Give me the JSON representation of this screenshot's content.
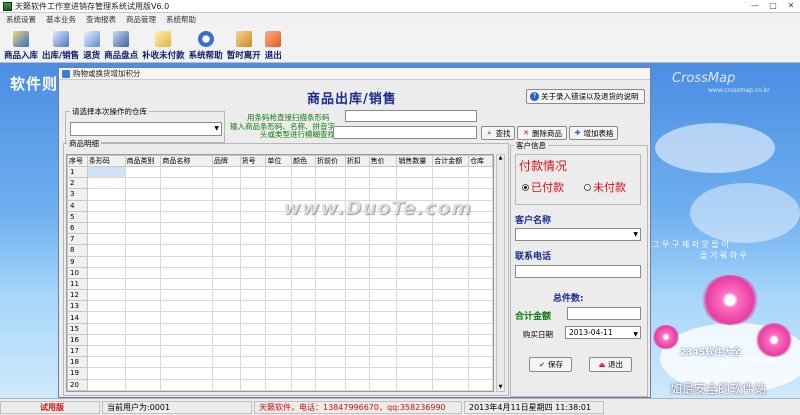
{
  "app": {
    "title": "天籁软件工作室进销存管理系统试用版V6.0"
  },
  "menubar": [
    "系统设置",
    "基本业务",
    "查询报表",
    "商品管理",
    "系统帮助"
  ],
  "toolbar": [
    {
      "label": "商品入库",
      "icon": "books-icon",
      "color": "#2f6fc6"
    },
    {
      "label": "出库/销售",
      "icon": "document-icon",
      "color": "#4a79c8"
    },
    {
      "label": "退货",
      "icon": "clipboard-icon",
      "color": "#5a8ad6"
    },
    {
      "label": "商品盘点",
      "icon": "calculator-icon",
      "color": "#3a5fa8"
    },
    {
      "label": "补收未付款",
      "icon": "folder-icon",
      "color": "#e0b43a"
    },
    {
      "label": "系统帮助",
      "icon": "help-icon",
      "color": "#3a6fd0"
    },
    {
      "label": "暂时离开",
      "icon": "keys-icon",
      "color": "#c98a2a"
    },
    {
      "label": "退出",
      "icon": "exit-icon",
      "color": "#e05a1e"
    }
  ],
  "desktop": {
    "left_text": "软件则",
    "logo": "CrossMap",
    "url": "www.crossmap.co.kr",
    "korean_line1": "그 우 구 제 자 뭇 랍 이",
    "korean_line2": "을 기 뭐 하 우",
    "bottom_text": "如最安全的软件站"
  },
  "watermarks": {
    "duote": "www.DuoTe.com",
    "brand": "2345软件大全",
    "brand_url": "www.DuoTe.com"
  },
  "dialog": {
    "title": "购物或换货增加积分",
    "heading": "商品出库/销售",
    "help_button": "关于录入错误以及退货的说明",
    "warehouse_label": "请选择本次操作的仓库",
    "scan_label": "用条码枪直接扫描条形码",
    "search_label": "输入商品条形码、名称、拼音字头或类型进行模糊查找",
    "find_button": "查找",
    "delete_button": "删除商品",
    "add_table_button": "增加表格",
    "detail_label": "商品明细",
    "columns": [
      "序号",
      "条形码",
      "商品类别",
      "商品名称",
      "品牌",
      "货号",
      "单位",
      "颜色",
      "折前价",
      "折扣",
      "售价",
      "销售数量",
      "合计金额",
      "仓库"
    ],
    "rows": [
      "1",
      "2",
      "3",
      "4",
      "5",
      "6",
      "7",
      "8",
      "9",
      "10",
      "11",
      "12",
      "13",
      "14",
      "15",
      "16",
      "17",
      "18",
      "19",
      "20"
    ],
    "customer": {
      "group_label": "客户信息",
      "pay_title": "付款情况",
      "paid_label": "已付款",
      "unpaid_label": "未付款",
      "name_label": "客户名称",
      "phone_label": "联系电话",
      "total_count_label": "总件数:",
      "total_amount_label": "合计金额",
      "date_label": "购买日期",
      "date_value": "2013-04-11",
      "save_button": "保存",
      "exit_button": "退出"
    }
  },
  "statusbar": {
    "trial": "试用版",
    "user": "当前用户为:0001",
    "vendor": "天籁软件，电话：13847996670，qq:358236990",
    "datetime": "2013年4月11日星期四  11:38:01"
  }
}
